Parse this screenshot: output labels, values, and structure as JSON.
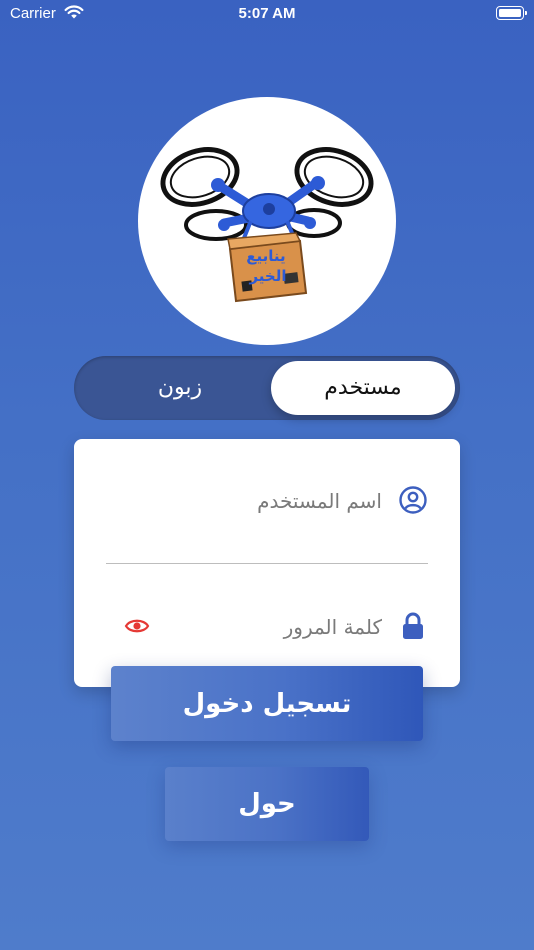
{
  "status_bar": {
    "carrier": "Carrier",
    "time": "5:07 AM"
  },
  "logo": {
    "text_line1": "ينابيع",
    "text_line2": "الخير"
  },
  "segment": {
    "selected": "user",
    "user_label": "مستخدم",
    "customer_label": "زبون"
  },
  "form": {
    "username_placeholder": "اسم المستخدم",
    "password_placeholder": "كلمة المرور"
  },
  "buttons": {
    "login_label": "تسجيل دخول",
    "about_label": "حول"
  },
  "colors": {
    "accent": "#3a62c1",
    "icon_blue": "#3d5fbf",
    "eye_red": "#e53935"
  }
}
